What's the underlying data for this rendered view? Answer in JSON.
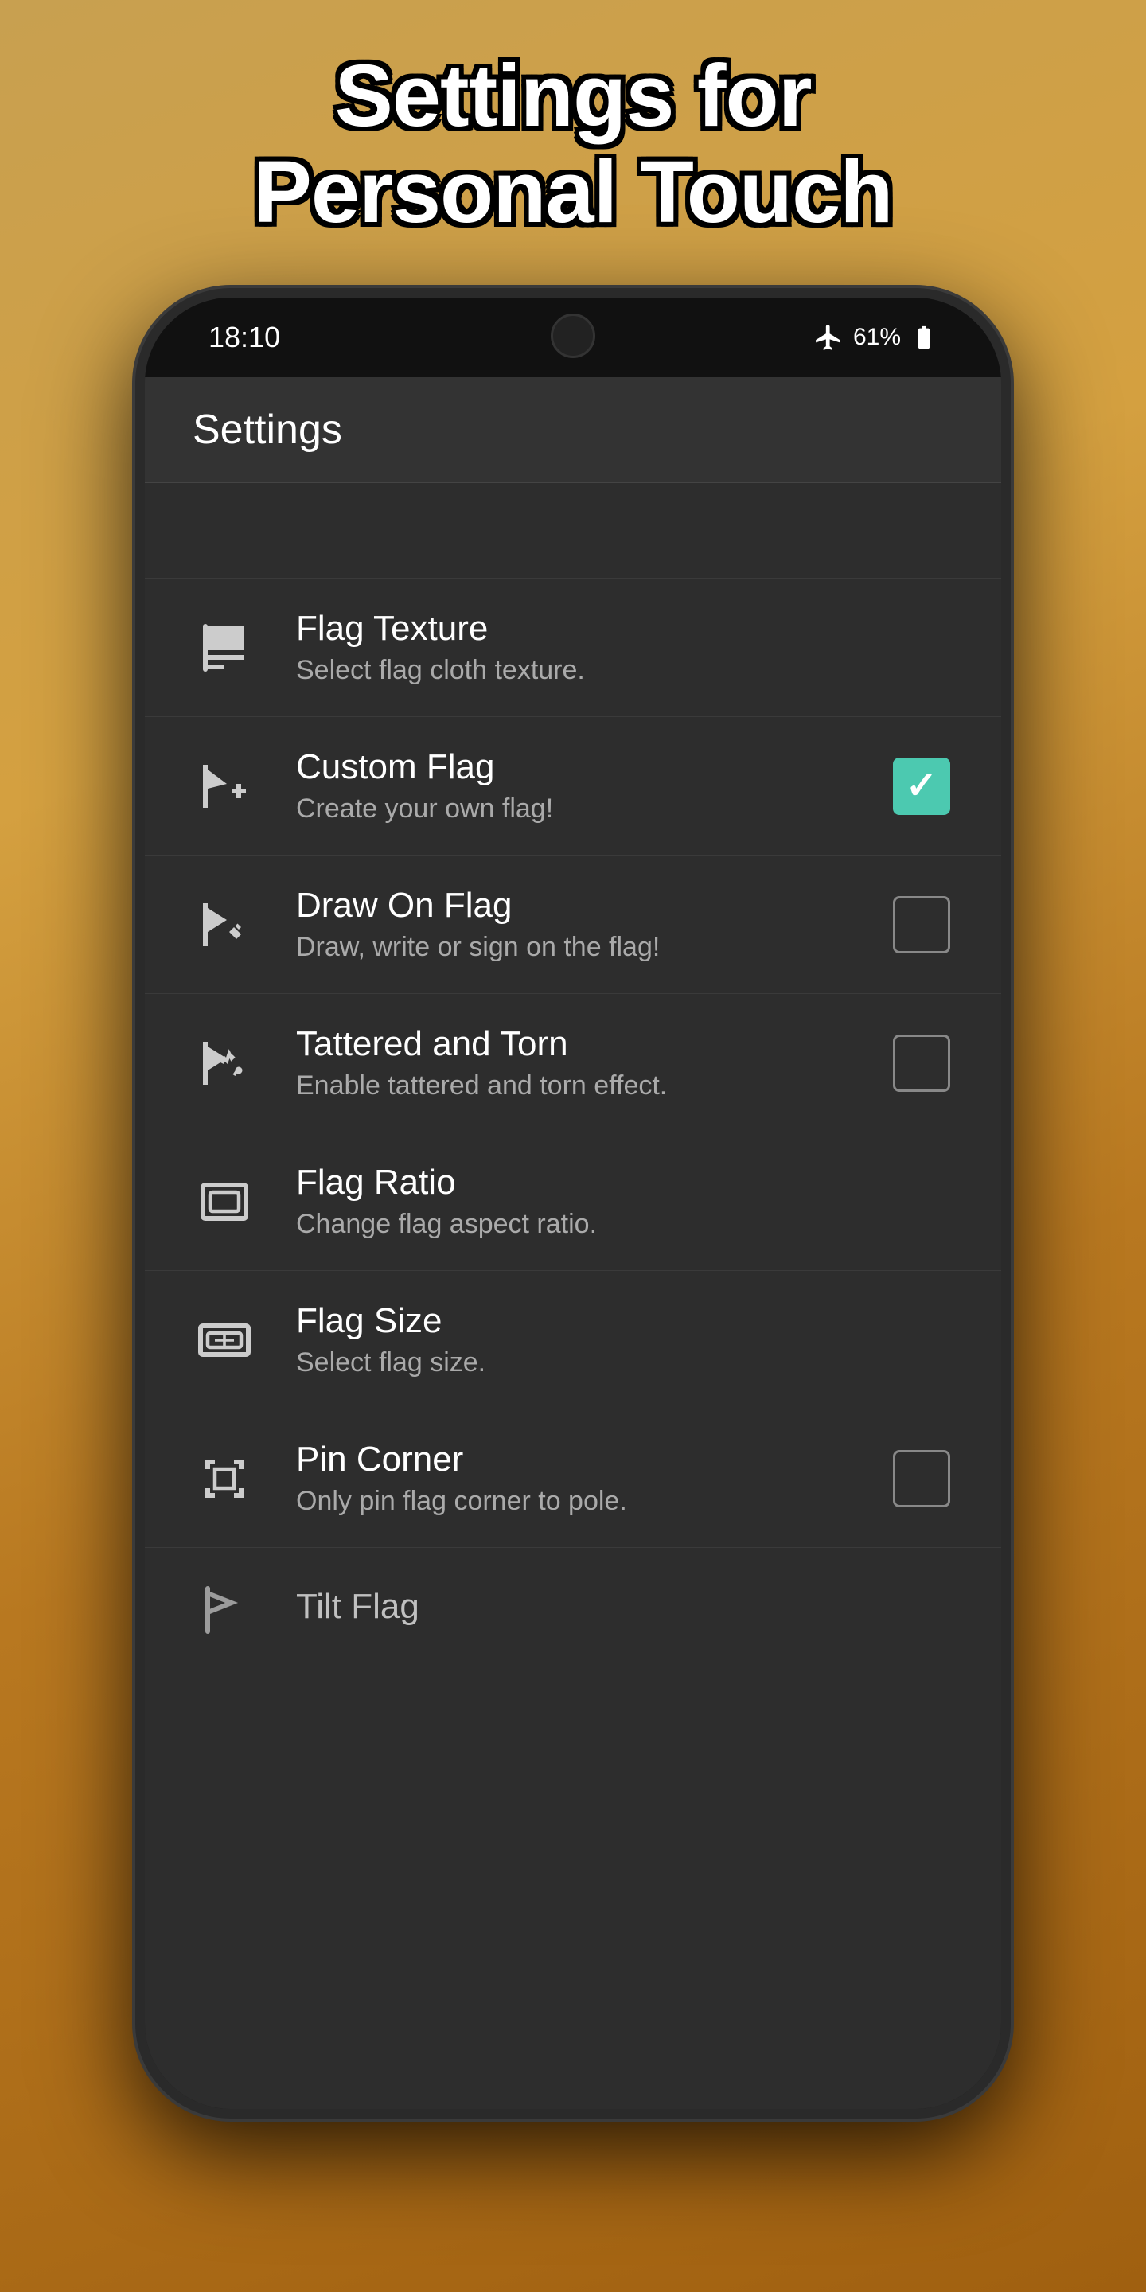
{
  "header": {
    "title_line1": "Settings for",
    "title_line2": "Personal Touch"
  },
  "status_bar": {
    "time": "18:10",
    "battery": "61%",
    "airplane_mode": true
  },
  "screen_title": "Settings",
  "settings": [
    {
      "id": "flag-texture",
      "title": "Flag Texture",
      "subtitle": "Select flag cloth texture.",
      "icon": "flag-texture-icon",
      "control": "none"
    },
    {
      "id": "custom-flag",
      "title": "Custom Flag",
      "subtitle": "Create your own flag!",
      "icon": "custom-flag-icon",
      "control": "checkbox",
      "checked": true
    },
    {
      "id": "draw-on-flag",
      "title": "Draw On Flag",
      "subtitle": "Draw, write or sign on the flag!",
      "icon": "draw-flag-icon",
      "control": "checkbox",
      "checked": false
    },
    {
      "id": "tattered-torn",
      "title": "Tattered and Torn",
      "subtitle": "Enable tattered and torn effect.",
      "icon": "tattered-flag-icon",
      "control": "checkbox",
      "checked": false
    },
    {
      "id": "flag-ratio",
      "title": "Flag Ratio",
      "subtitle": "Change flag aspect ratio.",
      "icon": "flag-ratio-icon",
      "control": "none"
    },
    {
      "id": "flag-size",
      "title": "Flag Size",
      "subtitle": "Select flag size.",
      "icon": "flag-size-icon",
      "control": "none"
    },
    {
      "id": "pin-corner",
      "title": "Pin Corner",
      "subtitle": "Only pin flag corner to pole.",
      "icon": "pin-corner-icon",
      "control": "checkbox",
      "checked": false
    },
    {
      "id": "tilt-flag",
      "title": "Tilt Flag",
      "subtitle": "",
      "icon": "tilt-flag-icon",
      "control": "none",
      "partial": true
    }
  ]
}
